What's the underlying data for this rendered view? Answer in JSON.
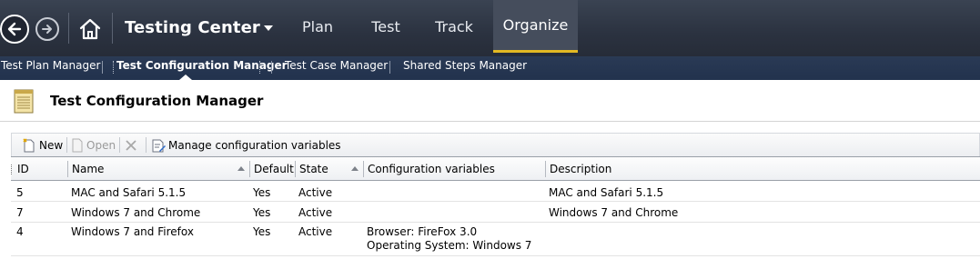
{
  "app": {
    "title": "Testing Center"
  },
  "main_tabs": [
    {
      "label": "Plan"
    },
    {
      "label": "Test"
    },
    {
      "label": "Track"
    },
    {
      "label": "Organize"
    }
  ],
  "sub_nav": [
    {
      "label": "Test Plan Manager"
    },
    {
      "label": "Test Configuration Manager"
    },
    {
      "label": "Test Case Manager"
    },
    {
      "label": "Shared Steps Manager"
    }
  ],
  "page": {
    "title": "Test Configuration Manager"
  },
  "toolbar": {
    "new_label": "New",
    "open_label": "Open",
    "manage_label": "Manage configuration variables"
  },
  "table": {
    "columns": [
      "ID",
      "Name",
      "Default",
      "State",
      "Configuration variables",
      "Description"
    ],
    "rows": [
      {
        "id": "5",
        "name": "MAC and Safari 5.1.5",
        "default": "Yes",
        "state": "Active",
        "vars": [
          "",
          ""
        ],
        "description": "MAC and Safari 5.1.5"
      },
      {
        "id": "7",
        "name": "Windows 7 and Chrome",
        "default": "Yes",
        "state": "Active",
        "vars": [
          "",
          ""
        ],
        "description": "Windows 7 and Chrome"
      },
      {
        "id": "4",
        "name": "Windows 7 and Firefox",
        "default": "Yes",
        "state": "Active",
        "vars": [
          "Browser: FireFox 3.0",
          "Operating System: Windows 7"
        ],
        "description": ""
      }
    ]
  },
  "colors": {
    "nav_bg": "#2b3240",
    "subnav_bg": "#22324d",
    "active_tab_accent": "#e3b923"
  }
}
